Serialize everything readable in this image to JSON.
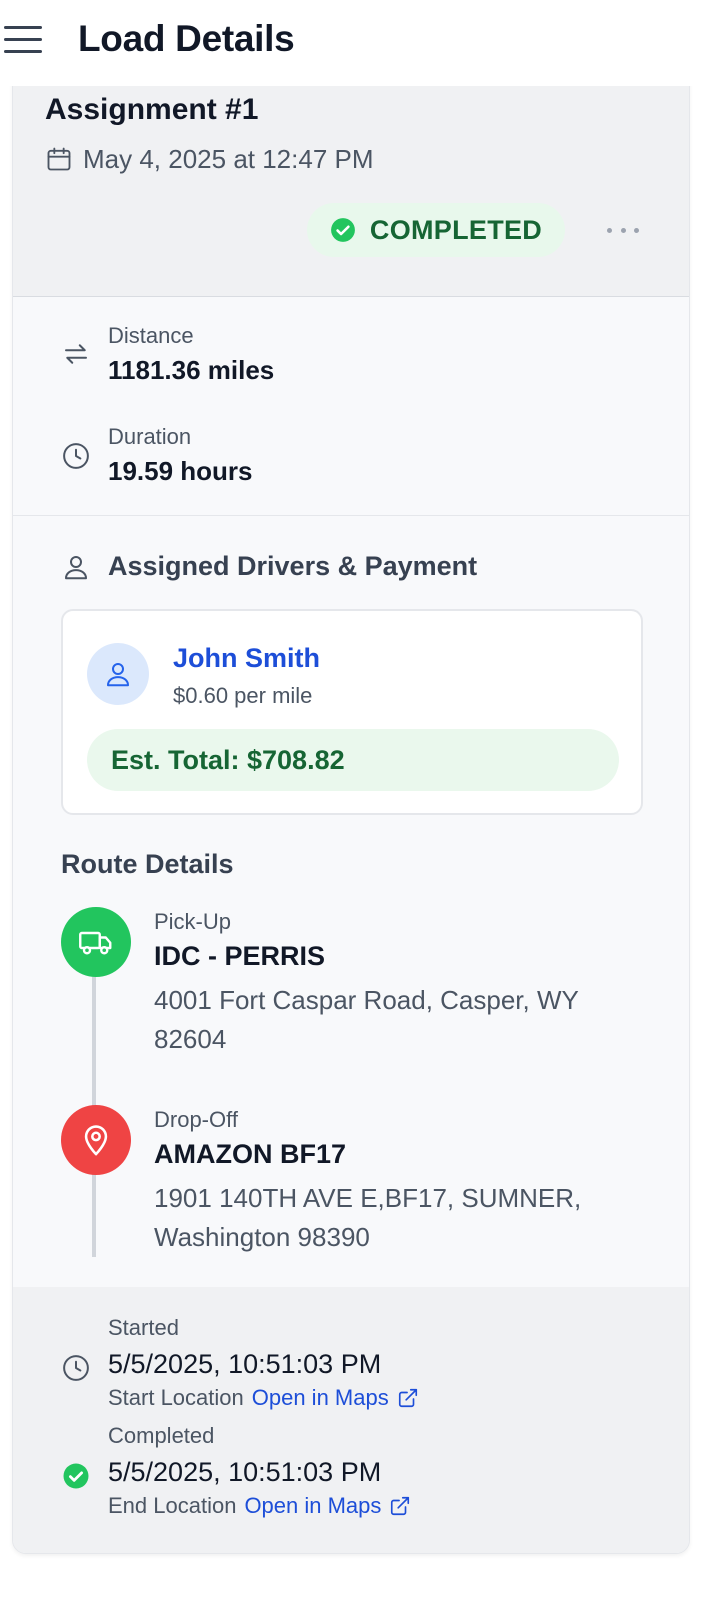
{
  "header": {
    "title": "Load Details"
  },
  "assignment": {
    "title": "Assignment #1",
    "date": "May 4, 2025 at 12:47 PM",
    "status": "COMPLETED"
  },
  "metrics": {
    "distance_label": "Distance",
    "distance_value": "1181.36 miles",
    "duration_label": "Duration",
    "duration_value": "19.59 hours"
  },
  "drivers": {
    "section_title": "Assigned Drivers & Payment",
    "name": "John Smith",
    "rate": "$0.60 per mile",
    "est_total": "Est. Total: $708.82"
  },
  "route": {
    "title": "Route Details",
    "pickup": {
      "label": "Pick-Up",
      "name": "IDC - PERRIS",
      "address": "4001 Fort Caspar Road, Casper, WY 82604"
    },
    "dropoff": {
      "label": "Drop-Off",
      "name": "AMAZON BF17",
      "address": "1901 140TH AVE E,BF17, SUMNER, Washington 98390"
    }
  },
  "tracking": {
    "started_label": "Started",
    "started_time": "5/5/2025, 10:51:03 PM",
    "start_location_label": "Start Location",
    "completed_label": "Completed",
    "completed_time": "5/5/2025, 10:51:03 PM",
    "end_location_label": "End Location",
    "open_in_maps": "Open in Maps"
  },
  "colors": {
    "success": "#22c55e",
    "danger": "#ef4444",
    "link": "#1d4ed8",
    "success_text": "#166534"
  },
  "icons": [
    "menu-icon",
    "calendar-icon",
    "check-circle-icon",
    "more-icon",
    "arrows-exchange-icon",
    "clock-icon",
    "user-icon",
    "truck-icon",
    "map-pin-icon",
    "external-link-icon"
  ]
}
